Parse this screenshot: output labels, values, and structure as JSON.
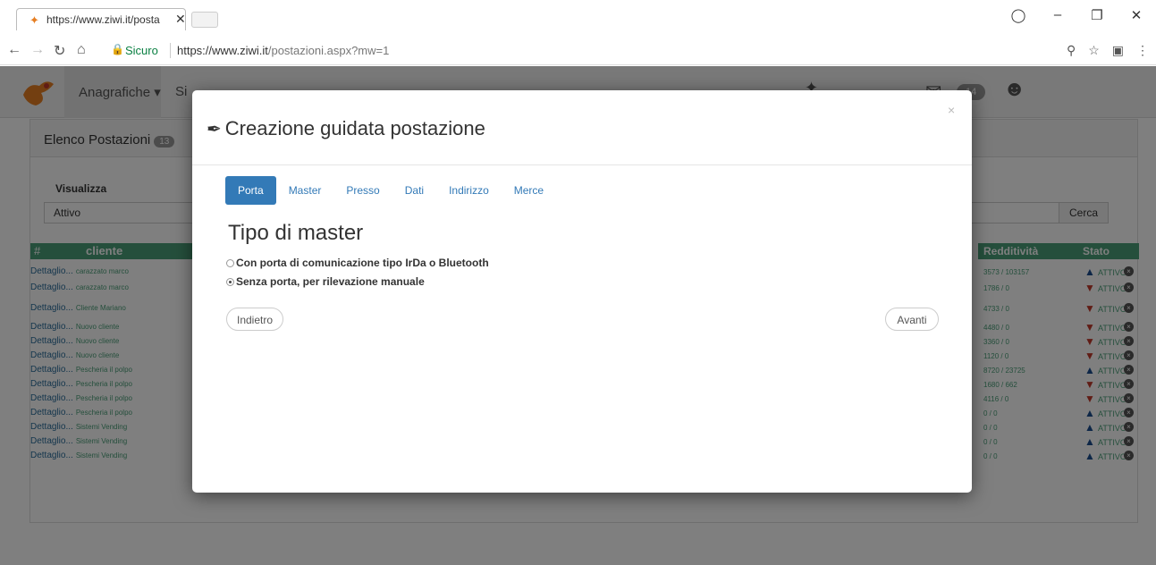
{
  "browser": {
    "tab_title": "https://www.ziwi.it/posta",
    "tab_close": "✕",
    "secure_label": "Sicuro",
    "url_host": "https://www.ziwi.it",
    "url_path": "/postazioni.aspx?mw=1"
  },
  "app": {
    "menu_anagrafiche": "Anagrafiche ▾",
    "menu_sistemi": "Si",
    "notif_badge": "14"
  },
  "panel": {
    "title": "Elenco Postazioni",
    "count": "13",
    "visualizza_label": "Visualizza",
    "visualizza_value": "Attivo",
    "cerca_button": "Cerca",
    "col_hash": "#",
    "col_cliente": "cliente",
    "col_redditivita": "Redditività",
    "col_stato": "Stato"
  },
  "rows": [
    {
      "det": "Dettaglio...",
      "cliente": "carazzato marco",
      "red": "3573 / 103157",
      "dir": "up",
      "stato": "ATTIVO"
    },
    {
      "det": "Dettaglio...",
      "cliente": "carazzato marco",
      "red": "1786 / 0",
      "dir": "down",
      "stato": "ATTIVO"
    },
    {
      "det": "Dettaglio...",
      "cliente": "Cliente Mariano",
      "red": "4733 / 0",
      "dir": "down",
      "stato": "ATTIVO"
    },
    {
      "det": "Dettaglio...",
      "cliente": "Nuovo cliente",
      "red": "4480 / 0",
      "dir": "down",
      "stato": "ATTIVO"
    },
    {
      "det": "Dettaglio...",
      "cliente": "Nuovo cliente",
      "red": "3360 / 0",
      "dir": "down",
      "stato": "ATTIVO"
    },
    {
      "det": "Dettaglio...",
      "cliente": "Nuovo cliente",
      "red": "1120 / 0",
      "dir": "down",
      "stato": "ATTIVO"
    },
    {
      "det": "Dettaglio...",
      "cliente": "Pescheria il polpo",
      "red": "8720 / 23725",
      "dir": "up",
      "stato": "ATTIVO"
    },
    {
      "det": "Dettaglio...",
      "cliente": "Pescheria il polpo",
      "red": "1680 / 662",
      "dir": "down",
      "stato": "ATTIVO"
    },
    {
      "det": "Dettaglio...",
      "cliente": "Pescheria il polpo",
      "red": "4116 / 0",
      "dir": "down",
      "stato": "ATTIVO"
    },
    {
      "det": "Dettaglio...",
      "cliente": "Pescheria il polpo",
      "red": "0 / 0",
      "dir": "up",
      "stato": "ATTIVO"
    },
    {
      "det": "Dettaglio...",
      "cliente": "Sistemi Vending",
      "red": "0 / 0",
      "dir": "up",
      "stato": "ATTIVO"
    },
    {
      "det": "Dettaglio...",
      "cliente": "Sistemi Vending",
      "red": "0 / 0",
      "dir": "up",
      "stato": "ATTIVO"
    },
    {
      "det": "Dettaglio...",
      "cliente": "Sistemi Vending",
      "red": "0 / 0",
      "dir": "up",
      "stato": "ATTIVO"
    }
  ],
  "modal": {
    "title": "Creazione guidata postazione",
    "close": "×",
    "tabs": [
      "Porta",
      "Master",
      "Presso",
      "Dati",
      "Indirizzo",
      "Merce"
    ],
    "active_tab": "Porta",
    "section_title": "Tipo di master",
    "option_1": "Con porta di comunicazione tipo IrDa o Bluetooth",
    "option_2": "Senza porta, per rilevazione manuale",
    "selected_option": "option_2",
    "back_button": "Indietro",
    "next_button": "Avanti"
  },
  "colors": {
    "accent": "#337ab7",
    "table_header": "#4a9e78",
    "arrow_up": "#1a4d8f",
    "arrow_down": "#c0392b"
  }
}
